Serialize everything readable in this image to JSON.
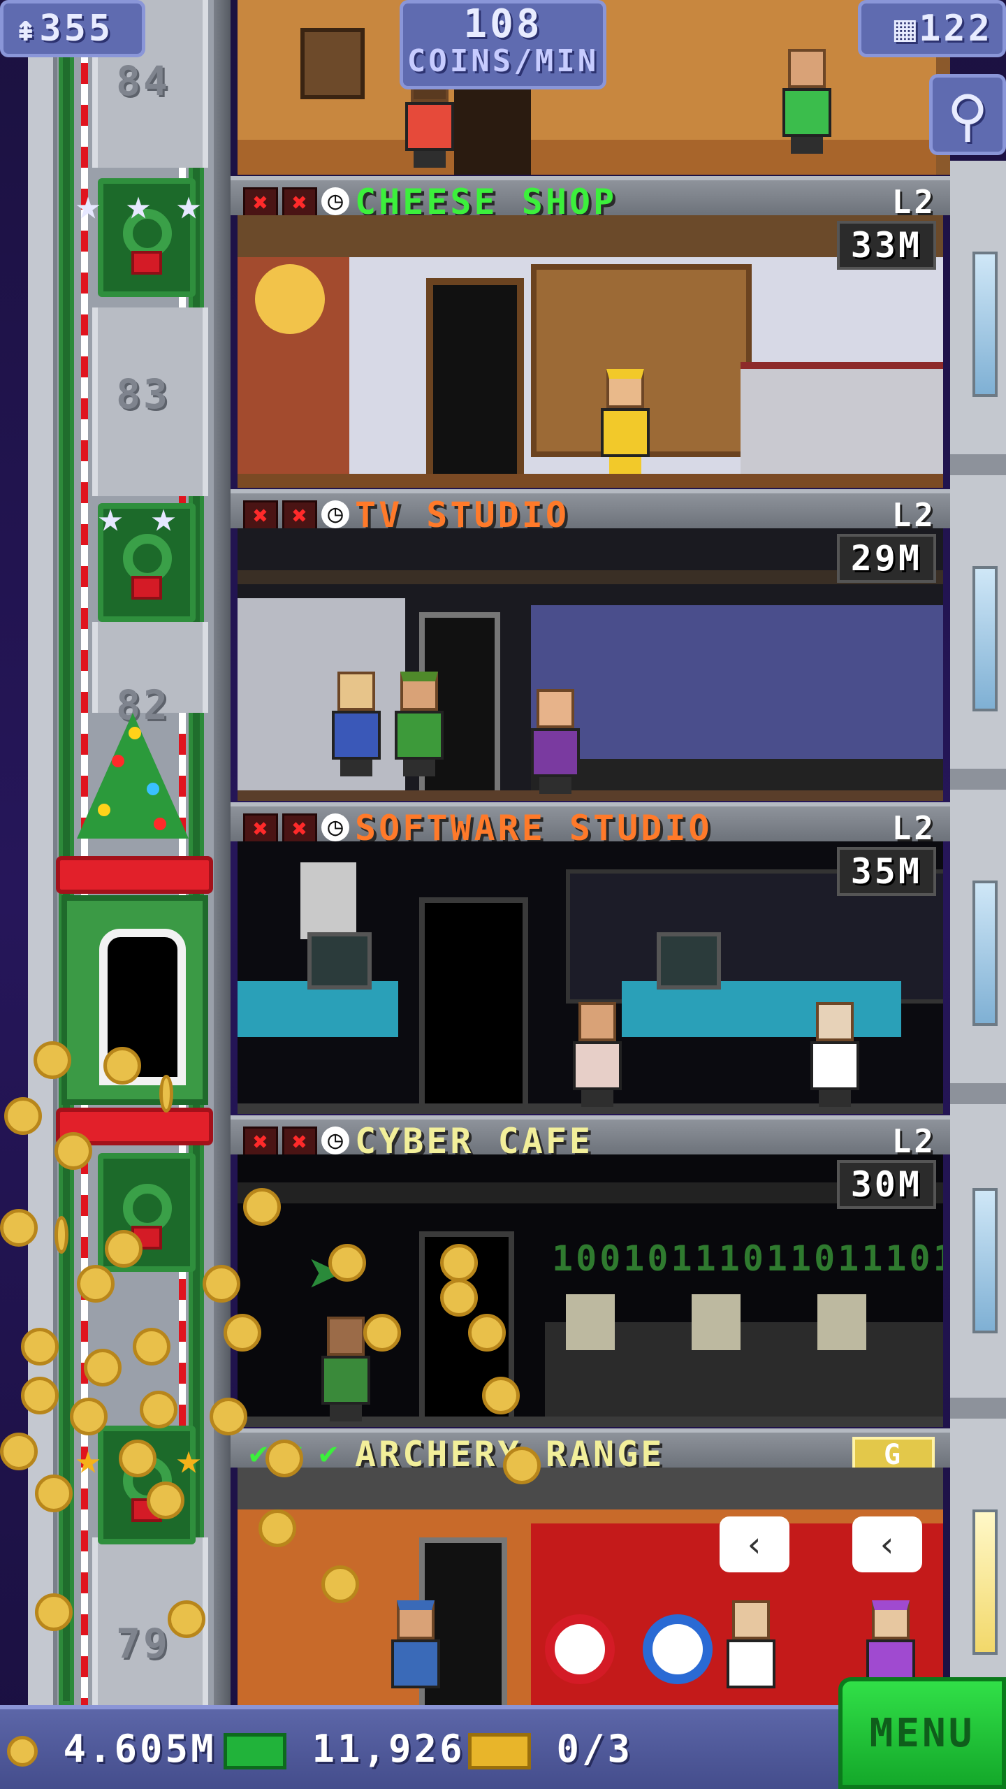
{
  "hud": {
    "population": "355",
    "income_value": "108",
    "income_unit": "COINS/MIN",
    "floor_count": "122"
  },
  "shaft": {
    "floor_labels": [
      "84",
      "83",
      "82",
      "79"
    ]
  },
  "floors": [
    {
      "name": "CHEESE SHOP",
      "level": "L2",
      "stock": "33M",
      "name_color": "#3cf03c"
    },
    {
      "name": "TV STUDIO",
      "level": "L2",
      "stock": "29M",
      "name_color": "#ff7a2a"
    },
    {
      "name": "SOFTWARE STUDIO",
      "level": "L2",
      "stock": "35M",
      "name_color": "#ff7a2a"
    },
    {
      "name": "CYBER CAFE",
      "level": "L2",
      "stock": "30M",
      "name_color": "#f2ef9a"
    },
    {
      "name": "ARCHERY RANGE",
      "gold_tag": "G",
      "name_color": "#f2ef9a"
    }
  ],
  "cyber_cafe_screen_text": "100101110110111011",
  "bottom_bar": {
    "coins": "4.605M",
    "bux": "11,926",
    "tickets": "0/3",
    "menu_label": "MENU"
  },
  "icons": {
    "population": "person-icon",
    "floors": "building-icon",
    "zoom": "magnifier-icon",
    "coins": "coin-icon",
    "bux": "bux-icon",
    "tickets": "ticket-icon"
  },
  "colors": {
    "hud_blue": "#5f6bb0",
    "menu_green": "#1fc635",
    "coin_gold": "#e9c04a",
    "restock_red": "#ff2a2a"
  }
}
